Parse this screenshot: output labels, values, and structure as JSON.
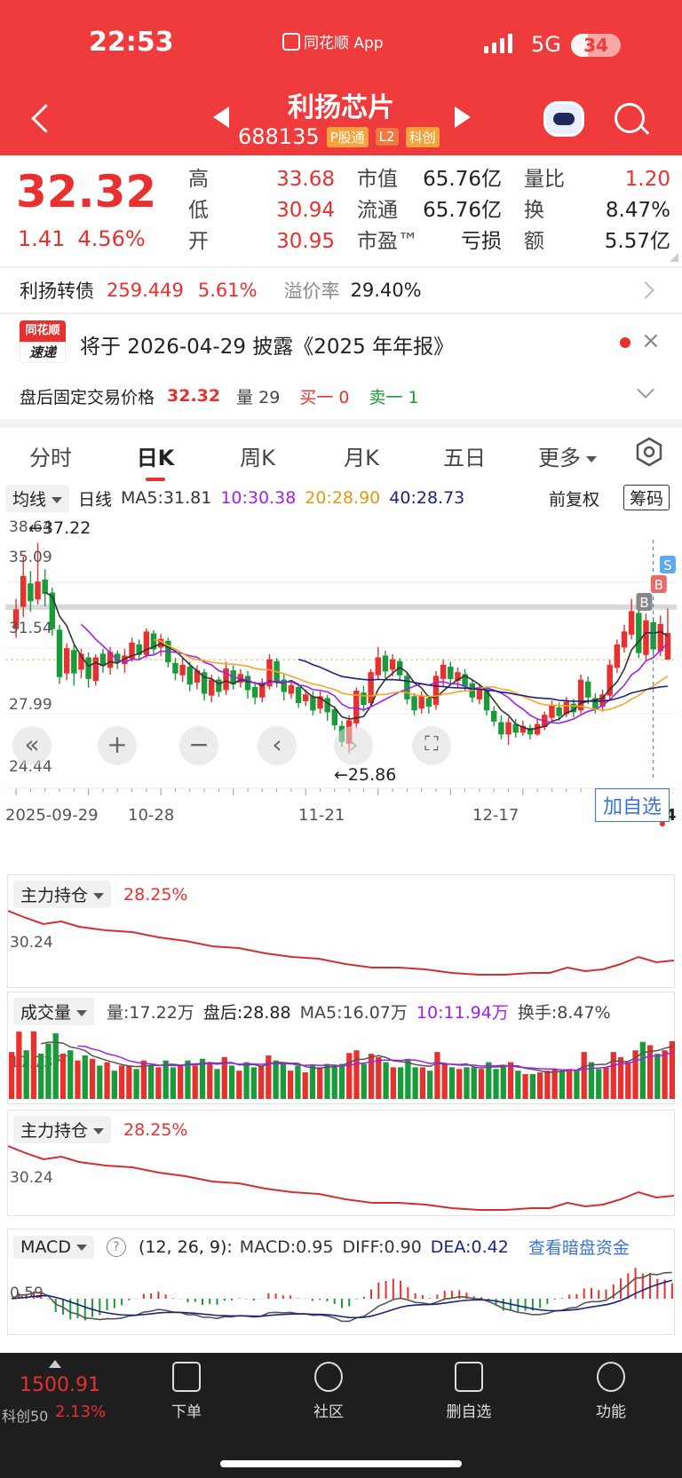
{
  "status": {
    "time": "22:53",
    "app": "同花顺 App",
    "network": "5G",
    "battery": "34",
    "battery_level": 0.34
  },
  "header": {
    "title": "利扬芯片",
    "code": "688135",
    "badges": [
      "P股通",
      "L2",
      "科创"
    ]
  },
  "quote": {
    "price": "32.32",
    "change": "1.41",
    "change_pct": "4.56%",
    "rows": [
      {
        "k1": "高",
        "v1": "33.68",
        "k2": "市值",
        "v2": "65.76亿",
        "k3": "量比",
        "v3": "1.20"
      },
      {
        "k1": "低",
        "v1": "30.94",
        "k2": "流通",
        "v2": "65.76亿",
        "k3": "换",
        "v3": "8.47%"
      },
      {
        "k1": "开",
        "v1": "30.95",
        "k2": "市盈™",
        "v2": "亏损",
        "k3": "额",
        "v3": "5.57亿"
      }
    ]
  },
  "bond": {
    "name": "利扬转债",
    "price": "259.449",
    "pct": "5.61%",
    "premium_label": "溢价率",
    "premium": "29.40%"
  },
  "notice": {
    "logo_top": "同花顺",
    "logo_bottom": "速递",
    "text": "将于 2026-04-29 披露《2025 年年报》"
  },
  "after_hours": {
    "label": "盘后固定交易价格",
    "price": "32.32",
    "volume": "量 29",
    "buy": "买一 0",
    "sell": "卖一 1"
  },
  "tabs": [
    "分时",
    "日K",
    "周K",
    "月K",
    "五日",
    "更多"
  ],
  "active_tab": 1,
  "ma_bar": {
    "select": "均线",
    "line": "日线",
    "ma5": "MA5:31.81",
    "ma10": "10:30.38",
    "ma20": "20:28.90",
    "ma40": "40:28.73",
    "adjust": "前复权",
    "chips": "筹码"
  },
  "colors": {
    "up": "#e8302f",
    "down": "#1a9b3a",
    "ma5": "#333333",
    "ma10": "#a020f0",
    "ma20": "#f5a623",
    "ma40": "#1a237e",
    "accent": "#3a74d6"
  },
  "chart": {
    "y_labels": [
      "38.64",
      "35.09",
      "31.54",
      "27.99",
      "24.44"
    ],
    "x_labels": [
      "2025-09-29",
      "10-28",
      "11-21",
      "12-17",
      "01-14"
    ],
    "high_label": "←37.22",
    "low_label": "←25.86",
    "add_watch": "加自选",
    "markers": [
      "S",
      "B",
      "B"
    ]
  },
  "chart_data": {
    "type": "candlestick",
    "ylim": [
      24.44,
      38.64
    ],
    "x_ticks": [
      "2025-09-29",
      "10-28",
      "11-21",
      "12-17",
      "01-14"
    ],
    "annotations": [
      {
        "label": "←37.22",
        "value": 37.22
      },
      {
        "label": "←25.86",
        "value": 25.86
      }
    ],
    "candles": [
      {
        "o": 32.6,
        "c": 33.6,
        "h": 34.2,
        "l": 32.1
      },
      {
        "o": 33.8,
        "c": 35.4,
        "h": 36.5,
        "l": 33.2
      },
      {
        "o": 35.0,
        "c": 34.1,
        "h": 35.7,
        "l": 33.5
      },
      {
        "o": 34.2,
        "c": 35.1,
        "h": 37.22,
        "l": 33.9
      },
      {
        "o": 35.2,
        "c": 34.5,
        "h": 35.8,
        "l": 33.8
      },
      {
        "o": 34.5,
        "c": 32.6,
        "h": 34.8,
        "l": 32.2
      },
      {
        "o": 32.5,
        "c": 30.0,
        "h": 32.8,
        "l": 29.6
      },
      {
        "o": 30.2,
        "c": 31.5,
        "h": 31.8,
        "l": 29.8
      },
      {
        "o": 31.4,
        "c": 30.2,
        "h": 31.7,
        "l": 29.5
      },
      {
        "o": 30.4,
        "c": 31.2,
        "h": 31.5,
        "l": 29.9
      },
      {
        "o": 31.0,
        "c": 29.9,
        "h": 31.3,
        "l": 29.4
      },
      {
        "o": 29.8,
        "c": 31.0,
        "h": 31.2,
        "l": 29.5
      },
      {
        "o": 31.2,
        "c": 30.6,
        "h": 31.5,
        "l": 30.2
      },
      {
        "o": 30.5,
        "c": 31.3,
        "h": 31.6,
        "l": 30.1
      },
      {
        "o": 31.2,
        "c": 30.8,
        "h": 31.4,
        "l": 30.4
      },
      {
        "o": 30.7,
        "c": 31.1,
        "h": 31.5,
        "l": 30.2
      },
      {
        "o": 31.0,
        "c": 31.8,
        "h": 32.1,
        "l": 30.8
      },
      {
        "o": 31.7,
        "c": 31.2,
        "h": 32.0,
        "l": 30.9
      },
      {
        "o": 31.2,
        "c": 32.4,
        "h": 32.6,
        "l": 31.0
      },
      {
        "o": 32.3,
        "c": 31.5,
        "h": 32.5,
        "l": 31.2
      },
      {
        "o": 31.6,
        "c": 32.0,
        "h": 32.3,
        "l": 31.1
      },
      {
        "o": 31.9,
        "c": 30.8,
        "h": 32.1,
        "l": 30.5
      },
      {
        "o": 30.7,
        "c": 30.2,
        "h": 31.0,
        "l": 29.8
      },
      {
        "o": 30.1,
        "c": 30.6,
        "h": 31.0,
        "l": 29.7
      },
      {
        "o": 30.5,
        "c": 29.6,
        "h": 30.8,
        "l": 29.2
      },
      {
        "o": 29.7,
        "c": 30.3,
        "h": 30.6,
        "l": 29.3
      },
      {
        "o": 30.2,
        "c": 29.1,
        "h": 30.4,
        "l": 28.7
      },
      {
        "o": 29.0,
        "c": 29.8,
        "h": 30.1,
        "l": 28.6
      },
      {
        "o": 29.8,
        "c": 29.2,
        "h": 30.0,
        "l": 28.9
      },
      {
        "o": 29.3,
        "c": 30.4,
        "h": 30.8,
        "l": 29.0
      },
      {
        "o": 30.3,
        "c": 29.6,
        "h": 30.6,
        "l": 29.3
      },
      {
        "o": 29.7,
        "c": 30.1,
        "h": 30.4,
        "l": 29.4
      },
      {
        "o": 30.0,
        "c": 29.3,
        "h": 30.3,
        "l": 28.8
      },
      {
        "o": 29.4,
        "c": 28.9,
        "h": 29.7,
        "l": 28.5
      },
      {
        "o": 28.9,
        "c": 29.6,
        "h": 29.9,
        "l": 28.6
      },
      {
        "o": 29.5,
        "c": 30.9,
        "h": 31.2,
        "l": 29.3
      },
      {
        "o": 30.8,
        "c": 29.7,
        "h": 31.0,
        "l": 29.4
      },
      {
        "o": 29.8,
        "c": 29.2,
        "h": 30.1,
        "l": 28.7
      },
      {
        "o": 29.1,
        "c": 29.5,
        "h": 29.8,
        "l": 28.8
      },
      {
        "o": 29.4,
        "c": 28.6,
        "h": 29.6,
        "l": 28.3
      },
      {
        "o": 28.7,
        "c": 29.0,
        "h": 29.3,
        "l": 28.4
      },
      {
        "o": 28.9,
        "c": 28.2,
        "h": 29.2,
        "l": 27.9
      },
      {
        "o": 28.3,
        "c": 28.9,
        "h": 29.2,
        "l": 28.0
      },
      {
        "o": 28.8,
        "c": 28.1,
        "h": 29.0,
        "l": 27.6
      },
      {
        "o": 28.2,
        "c": 27.4,
        "h": 28.4,
        "l": 27.1
      },
      {
        "o": 27.3,
        "c": 26.5,
        "h": 27.6,
        "l": 26.2
      },
      {
        "o": 26.4,
        "c": 27.6,
        "h": 27.9,
        "l": 25.86
      },
      {
        "o": 27.5,
        "c": 29.2,
        "h": 29.4,
        "l": 27.2
      },
      {
        "o": 29.1,
        "c": 28.5,
        "h": 29.5,
        "l": 28.1
      },
      {
        "o": 28.6,
        "c": 30.2,
        "h": 30.4,
        "l": 28.4
      },
      {
        "o": 30.1,
        "c": 31.0,
        "h": 31.6,
        "l": 29.8
      },
      {
        "o": 31.1,
        "c": 30.3,
        "h": 31.4,
        "l": 29.9
      },
      {
        "o": 30.4,
        "c": 30.9,
        "h": 31.2,
        "l": 30.0
      },
      {
        "o": 30.8,
        "c": 30.1,
        "h": 31.0,
        "l": 29.8
      },
      {
        "o": 30.0,
        "c": 28.8,
        "h": 30.2,
        "l": 28.5
      },
      {
        "o": 28.9,
        "c": 28.2,
        "h": 29.1,
        "l": 27.9
      },
      {
        "o": 28.3,
        "c": 28.9,
        "h": 29.2,
        "l": 28.0
      },
      {
        "o": 28.8,
        "c": 28.4,
        "h": 29.0,
        "l": 28.0
      },
      {
        "o": 28.5,
        "c": 30.0,
        "h": 30.3,
        "l": 28.2
      },
      {
        "o": 29.9,
        "c": 30.6,
        "h": 30.9,
        "l": 29.5
      },
      {
        "o": 30.5,
        "c": 29.9,
        "h": 30.8,
        "l": 29.6
      },
      {
        "o": 29.8,
        "c": 30.2,
        "h": 30.5,
        "l": 29.4
      },
      {
        "o": 30.1,
        "c": 29.5,
        "h": 30.4,
        "l": 29.2
      },
      {
        "o": 29.6,
        "c": 28.9,
        "h": 29.8,
        "l": 28.6
      },
      {
        "o": 28.8,
        "c": 29.3,
        "h": 29.6,
        "l": 28.5
      },
      {
        "o": 29.2,
        "c": 28.2,
        "h": 29.4,
        "l": 27.9
      },
      {
        "o": 28.1,
        "c": 27.6,
        "h": 28.4,
        "l": 27.3
      },
      {
        "o": 27.5,
        "c": 26.9,
        "h": 27.9,
        "l": 26.6
      },
      {
        "o": 26.9,
        "c": 27.5,
        "h": 27.8,
        "l": 26.3
      },
      {
        "o": 27.4,
        "c": 27.0,
        "h": 27.7,
        "l": 26.7
      },
      {
        "o": 27.0,
        "c": 27.3,
        "h": 27.6,
        "l": 26.8
      },
      {
        "o": 27.2,
        "c": 26.9,
        "h": 27.4,
        "l": 26.6
      },
      {
        "o": 26.9,
        "c": 27.4,
        "h": 27.7,
        "l": 26.8
      },
      {
        "o": 27.3,
        "c": 27.9,
        "h": 28.1,
        "l": 27.1
      },
      {
        "o": 27.8,
        "c": 28.4,
        "h": 28.7,
        "l": 27.6
      },
      {
        "o": 28.3,
        "c": 27.9,
        "h": 28.6,
        "l": 27.6
      },
      {
        "o": 28.0,
        "c": 28.6,
        "h": 28.9,
        "l": 27.8
      },
      {
        "o": 28.5,
        "c": 28.1,
        "h": 28.8,
        "l": 27.8
      },
      {
        "o": 28.2,
        "c": 29.8,
        "h": 30.1,
        "l": 28.0
      },
      {
        "o": 29.7,
        "c": 28.9,
        "h": 30.0,
        "l": 28.5
      },
      {
        "o": 28.8,
        "c": 28.3,
        "h": 29.1,
        "l": 28.0
      },
      {
        "o": 28.4,
        "c": 29.0,
        "h": 29.3,
        "l": 28.1
      },
      {
        "o": 29.0,
        "c": 30.6,
        "h": 30.9,
        "l": 28.8
      },
      {
        "o": 30.5,
        "c": 31.7,
        "h": 32.0,
        "l": 30.2
      },
      {
        "o": 31.6,
        "c": 32.4,
        "h": 32.8,
        "l": 31.3
      },
      {
        "o": 32.3,
        "c": 33.5,
        "h": 34.2,
        "l": 32.0
      },
      {
        "o": 33.4,
        "c": 31.3,
        "h": 33.7,
        "l": 31.0
      },
      {
        "o": 31.2,
        "c": 33.0,
        "h": 33.4,
        "l": 30.9
      },
      {
        "o": 32.9,
        "c": 31.5,
        "h": 33.2,
        "l": 31.2
      },
      {
        "o": 31.4,
        "c": 32.8,
        "h": 33.3,
        "l": 31.1
      },
      {
        "o": 30.95,
        "c": 32.32,
        "h": 33.68,
        "l": 30.94
      }
    ]
  },
  "panel1": {
    "select": "主力持仓",
    "value": "28.25%",
    "ylabel": "30.24"
  },
  "panel2": {
    "select": "成交量",
    "vol": "量:17.22万",
    "after": "盘后:28.88",
    "ma5": "MA5:16.07万",
    "ma10": "10:11.94万",
    "turn": "换手:8.47%",
    "ylabel": "17.73万"
  },
  "panel3": {
    "select": "主力持仓",
    "value": "28.25%",
    "ylabel": "30.24"
  },
  "panel4": {
    "select": "MACD",
    "params": "(12, 26, 9):",
    "macd": "MACD:0.95",
    "diff": "DIFF:0.90",
    "dea": "DEA:0.42",
    "link": "查看暗盘资金",
    "ylabel": "0.59"
  },
  "bottom": {
    "index_value": "1500.91",
    "index_name": "科创50",
    "index_pct": "2.13%",
    "buttons": [
      "下单",
      "社区",
      "删自选",
      "功能"
    ]
  }
}
